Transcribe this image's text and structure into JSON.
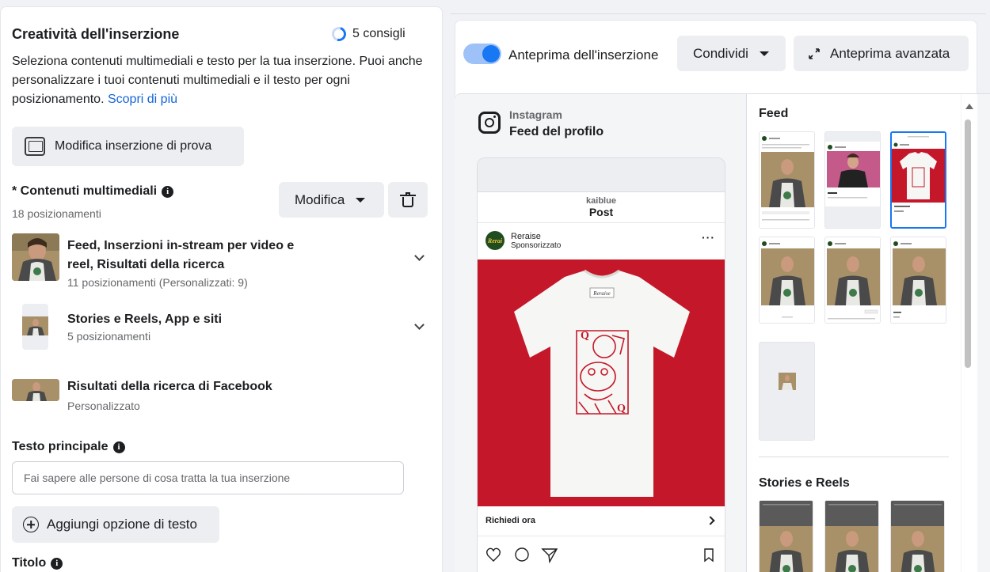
{
  "left": {
    "title": "Creatività dell'inserzione",
    "tips": "5 consigli",
    "description": "Seleziona contenuti multimediali e testo per la tua inserzione. Puoi anche personalizzare i tuoi contenuti multimediali e il testo per ogni posizionamento.",
    "learn_more": "Scopri di più",
    "test_button": "Modifica inserzione di prova",
    "media": {
      "title": "* Contenuti multimediali",
      "count": "18 posizionamenti",
      "edit_button": "Modifica"
    },
    "placements": [
      {
        "title_line1": "Feed, Inserzioni in-stream per video e",
        "title_line2": "reel, Risultati della ricerca",
        "sub": "11 posizionamenti (Personalizzati: 9)"
      },
      {
        "title_line1": "Stories e Reels, App e siti",
        "sub": "5 posizionamenti"
      },
      {
        "title_line1": "Risultati della ricerca di Facebook",
        "sub": "Personalizzato"
      }
    ],
    "primary_text": {
      "title": "Testo principale",
      "placeholder": "Fai sapere alle persone di cosa tratta la tua inserzione",
      "add_button": "Aggiungi opzione di testo"
    },
    "headline": {
      "title": "Titolo"
    }
  },
  "right": {
    "toggle_label": "Anteprima dell'inserzione",
    "share_button": "Condividi",
    "advanced_button": "Anteprima avanzata",
    "platform": "Instagram",
    "placement": "Feed del profilo",
    "phone": {
      "username": "kaiblue",
      "header": "Post",
      "account": "Reraise",
      "sponsored": "Sponsorizzato",
      "avatar_text": "Rerai",
      "cta": "Richiedi ora",
      "tshirt_label": "Reraise"
    },
    "gallery": {
      "feed_title": "Feed",
      "stories_title": "Stories e Reels"
    }
  },
  "colors": {
    "accent": "#1877f2",
    "link": "#1465d8",
    "ad_background": "#c4182a"
  }
}
